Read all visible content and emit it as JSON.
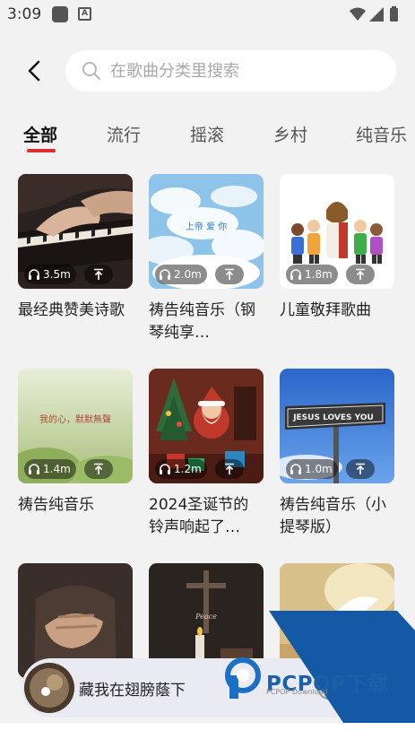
{
  "status_bar": {
    "time": "3:09",
    "a_badge": "A"
  },
  "search": {
    "placeholder": "在歌曲分类里搜索"
  },
  "tabs": [
    {
      "label": "全部"
    },
    {
      "label": "流行"
    },
    {
      "label": "摇滚"
    },
    {
      "label": "乡村"
    },
    {
      "label": "纯音乐"
    }
  ],
  "cards": [
    {
      "title": "最经典赞美诗歌",
      "plays": "3.5m",
      "cover_text": ""
    },
    {
      "title": "祷告纯音乐（钢琴纯享…",
      "plays": "2.0m",
      "cover_text": "上帝  爱  你"
    },
    {
      "title": "儿童敬拜歌曲",
      "plays": "1.8m",
      "cover_text": ""
    },
    {
      "title": "祷告纯音乐",
      "plays": "1.4m",
      "cover_text": "我的心，默默無聲"
    },
    {
      "title": "2024圣诞节的铃声响起了…",
      "plays": "1.2m",
      "cover_text": ""
    },
    {
      "title": "祷告纯音乐（小提琴版）",
      "plays": "1.0m",
      "cover_text": "JESUS LOVES YOU"
    },
    {
      "title": "",
      "plays": "",
      "cover_text": ""
    },
    {
      "title": "",
      "plays": "",
      "cover_text": "Peace"
    },
    {
      "title": "",
      "plays": "",
      "cover_text": ""
    }
  ],
  "player": {
    "title": "藏我在翅膀蔭下"
  },
  "watermark": {
    "brand": "PCPOP下载",
    "sub": "PCPOP Download"
  },
  "colors": {
    "accent": "#e02e2e",
    "watermark_blue": "#1c60a8"
  }
}
